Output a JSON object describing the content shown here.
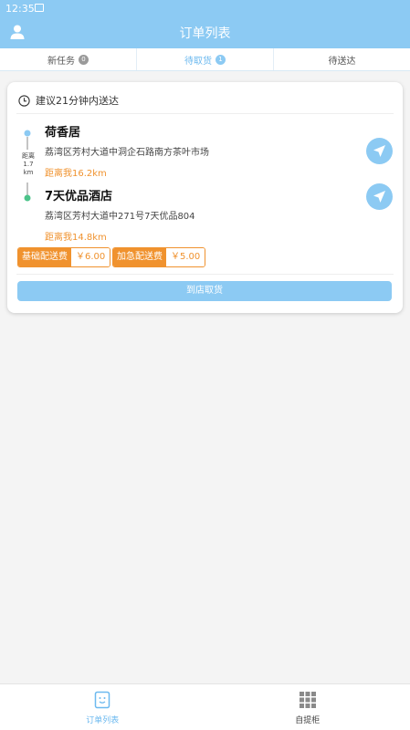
{
  "status_bar": {
    "time": "12:35"
  },
  "header": {
    "title": "订单列表"
  },
  "tabs": [
    {
      "label": "新任务",
      "badge": "0"
    },
    {
      "label": "待取货",
      "badge": "1"
    },
    {
      "label": "待送达"
    }
  ],
  "order": {
    "hint": "建议21分钟内送达",
    "store": {
      "name": "荷香居",
      "address": "荔湾区芳村大道中洞企石路南方茶叶市场",
      "distance": "距离我16.2km"
    },
    "route_distance": {
      "label": "距离",
      "value": "1.7",
      "unit": "km"
    },
    "customer": {
      "name": "7天优品酒店",
      "address": "荔湾区芳村大道中271号7天优品804",
      "distance": "距离我14.8km"
    },
    "fees": [
      {
        "label": "基础配送费",
        "value": "￥6.00"
      },
      {
        "label": "加急配送费",
        "value": "￥5.00"
      }
    ],
    "action": "到店取货"
  },
  "bottom_nav": [
    {
      "label": "订单列表",
      "icon": "order-list-icon"
    },
    {
      "label": "自提柜",
      "icon": "grid-icon"
    }
  ],
  "colors": {
    "primary": "#8ccaf3",
    "accent": "#f0922e"
  }
}
